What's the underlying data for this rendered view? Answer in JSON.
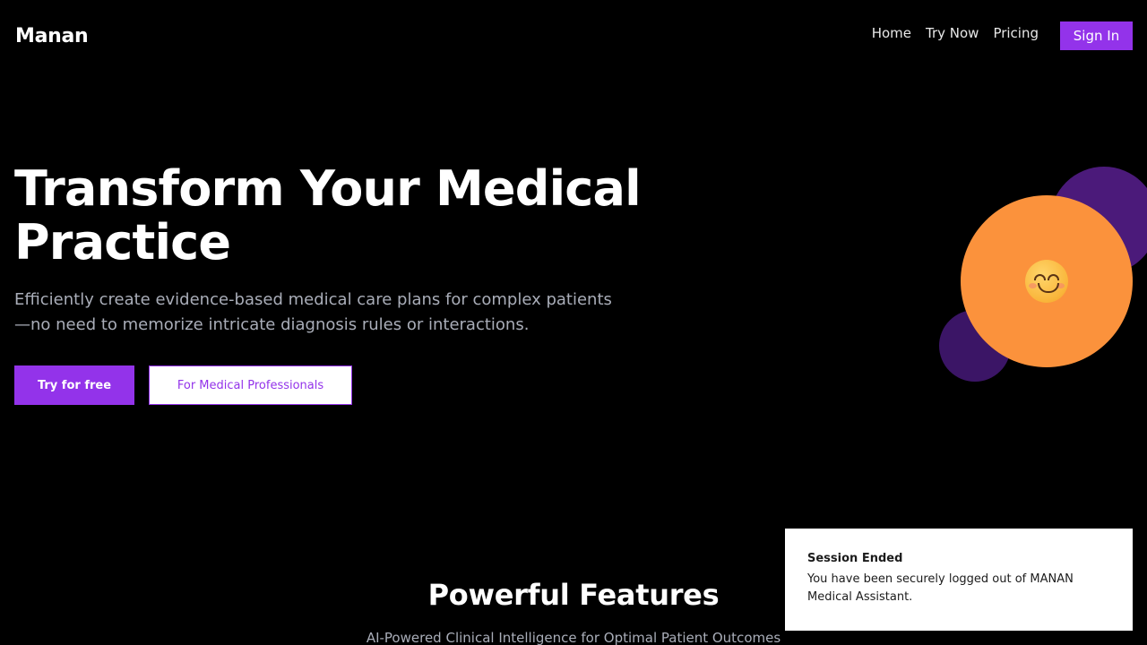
{
  "header": {
    "logo": "Manan",
    "nav": {
      "home": "Home",
      "try_now": "Try Now",
      "pricing": "Pricing",
      "sign_in": "Sign In"
    }
  },
  "hero": {
    "title": "Transform Your Medical Practice",
    "subtitle": "Efficiently create evidence-based medical care plans for complex patients—no need to memorize intricate diagnosis rules or interactions.",
    "primary_button": "Try for free",
    "secondary_button": "For Medical Professionals",
    "illustration_icon": "smiling-face-emoji"
  },
  "features": {
    "title": "Powerful Features",
    "subtitle": "AI-Powered Clinical Intelligence for Optimal Patient Outcomes"
  },
  "toast": {
    "title": "Session Ended",
    "message": "You have been securely logged out of MANAN Medical Assistant."
  },
  "colors": {
    "background": "#000000",
    "accent": "#9333ea",
    "orange": "#fb923c",
    "deep_purple": "#4b1a7a"
  }
}
